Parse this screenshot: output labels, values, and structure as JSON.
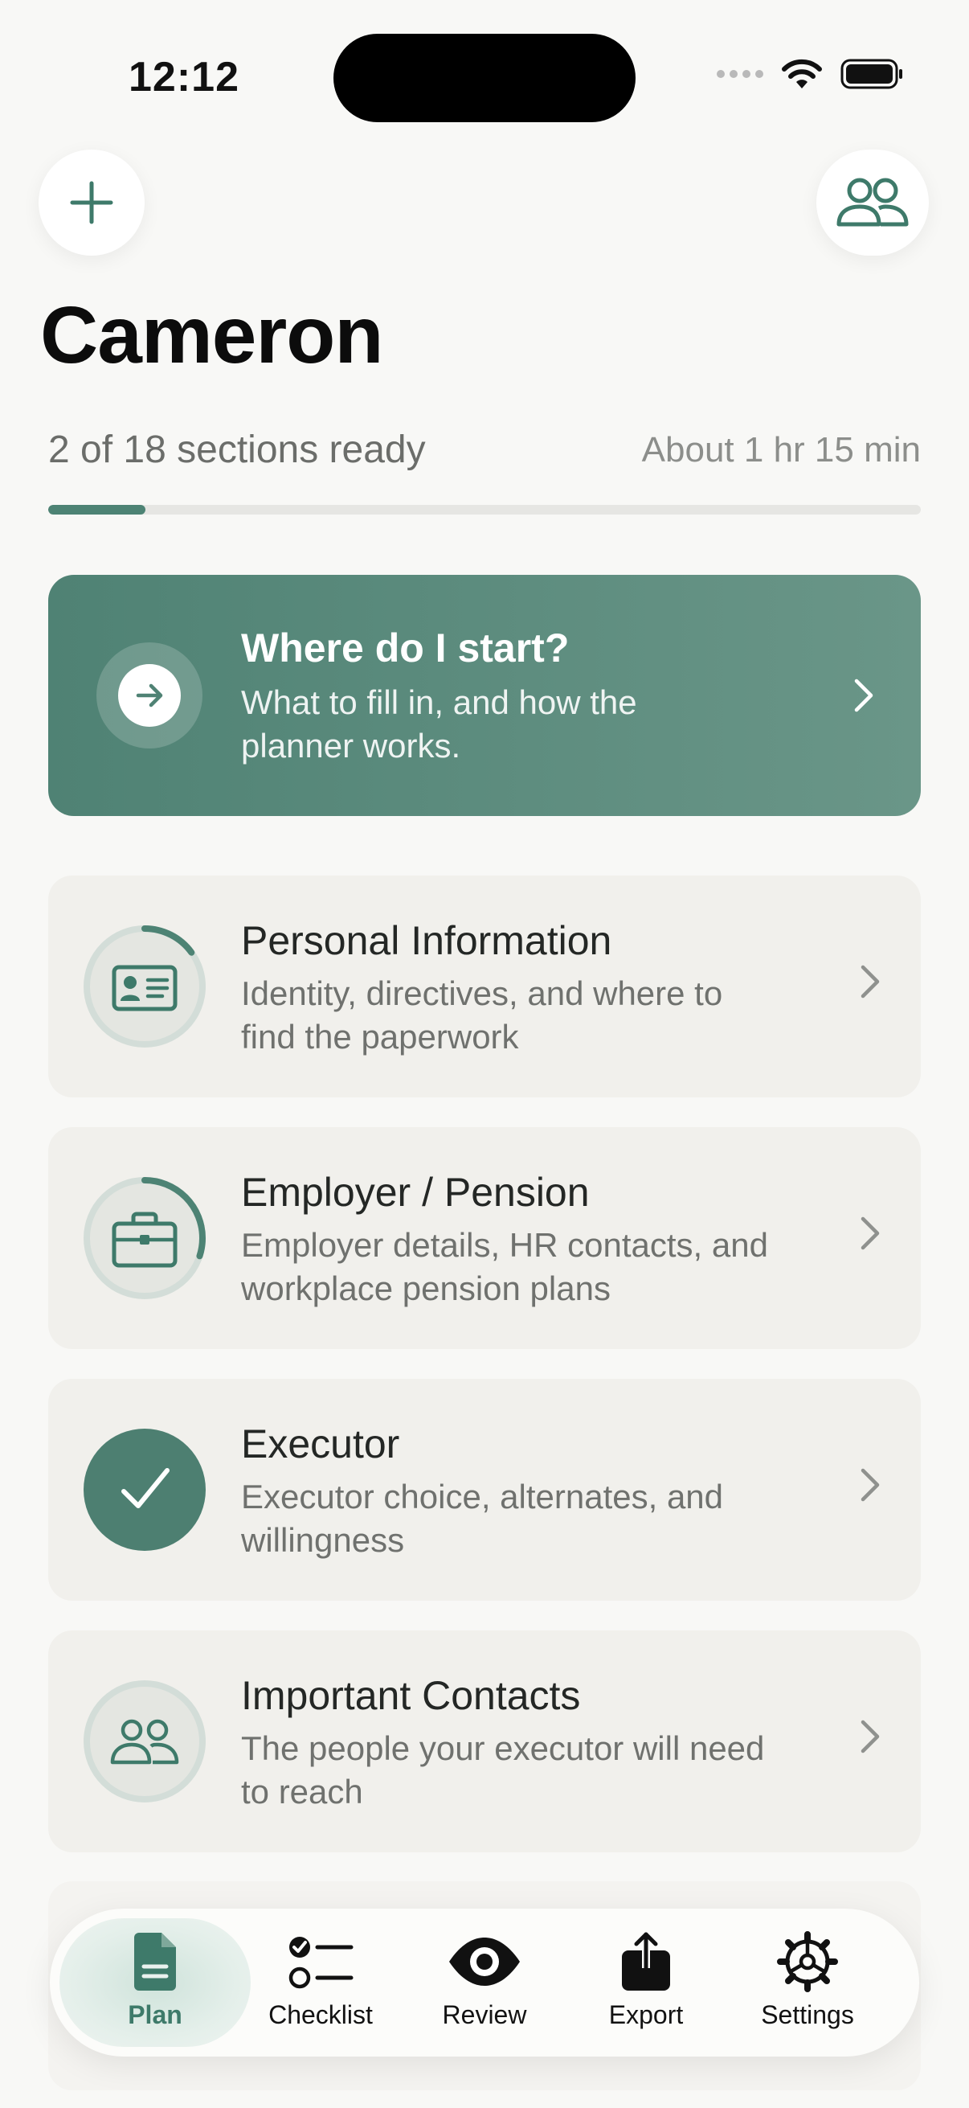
{
  "status": {
    "time": "12:12"
  },
  "header": {
    "title": "Cameron",
    "progress_text": "2 of 18 sections ready",
    "time_estimate": "About 1 hr 15 min",
    "progress_fraction": 0.111
  },
  "start_card": {
    "title": "Where do I start?",
    "subtitle": "What to fill in, and how the planner works."
  },
  "sections": [
    {
      "title": "Personal Information",
      "description": "Identity, directives, and where to find the paperwork",
      "icon": "id-card-icon",
      "status": "in-progress",
      "progress": 0.15
    },
    {
      "title": "Employer / Pension",
      "description": "Employer details, HR contacts, and workplace pension plans",
      "icon": "briefcase-icon",
      "status": "in-progress",
      "progress": 0.3
    },
    {
      "title": "Executor",
      "description": "Executor choice, alternates, and willingness",
      "icon": "checkmark-icon",
      "status": "complete",
      "progress": 1
    },
    {
      "title": "Important Contacts",
      "description": "The people your executor will need to reach",
      "icon": "people-icon",
      "status": "not-started",
      "progress": 0
    }
  ],
  "tabs": [
    {
      "label": "Plan",
      "icon": "document-icon",
      "active": true
    },
    {
      "label": "Checklist",
      "icon": "checklist-icon",
      "active": false
    },
    {
      "label": "Review",
      "icon": "eye-icon",
      "active": false
    },
    {
      "label": "Export",
      "icon": "share-icon",
      "active": false
    },
    {
      "label": "Settings",
      "icon": "gear-icon",
      "active": false
    }
  ],
  "colors": {
    "accent": "#4d8374",
    "card_bg": "#f1f0ec",
    "page_bg": "#f8f8f6"
  }
}
